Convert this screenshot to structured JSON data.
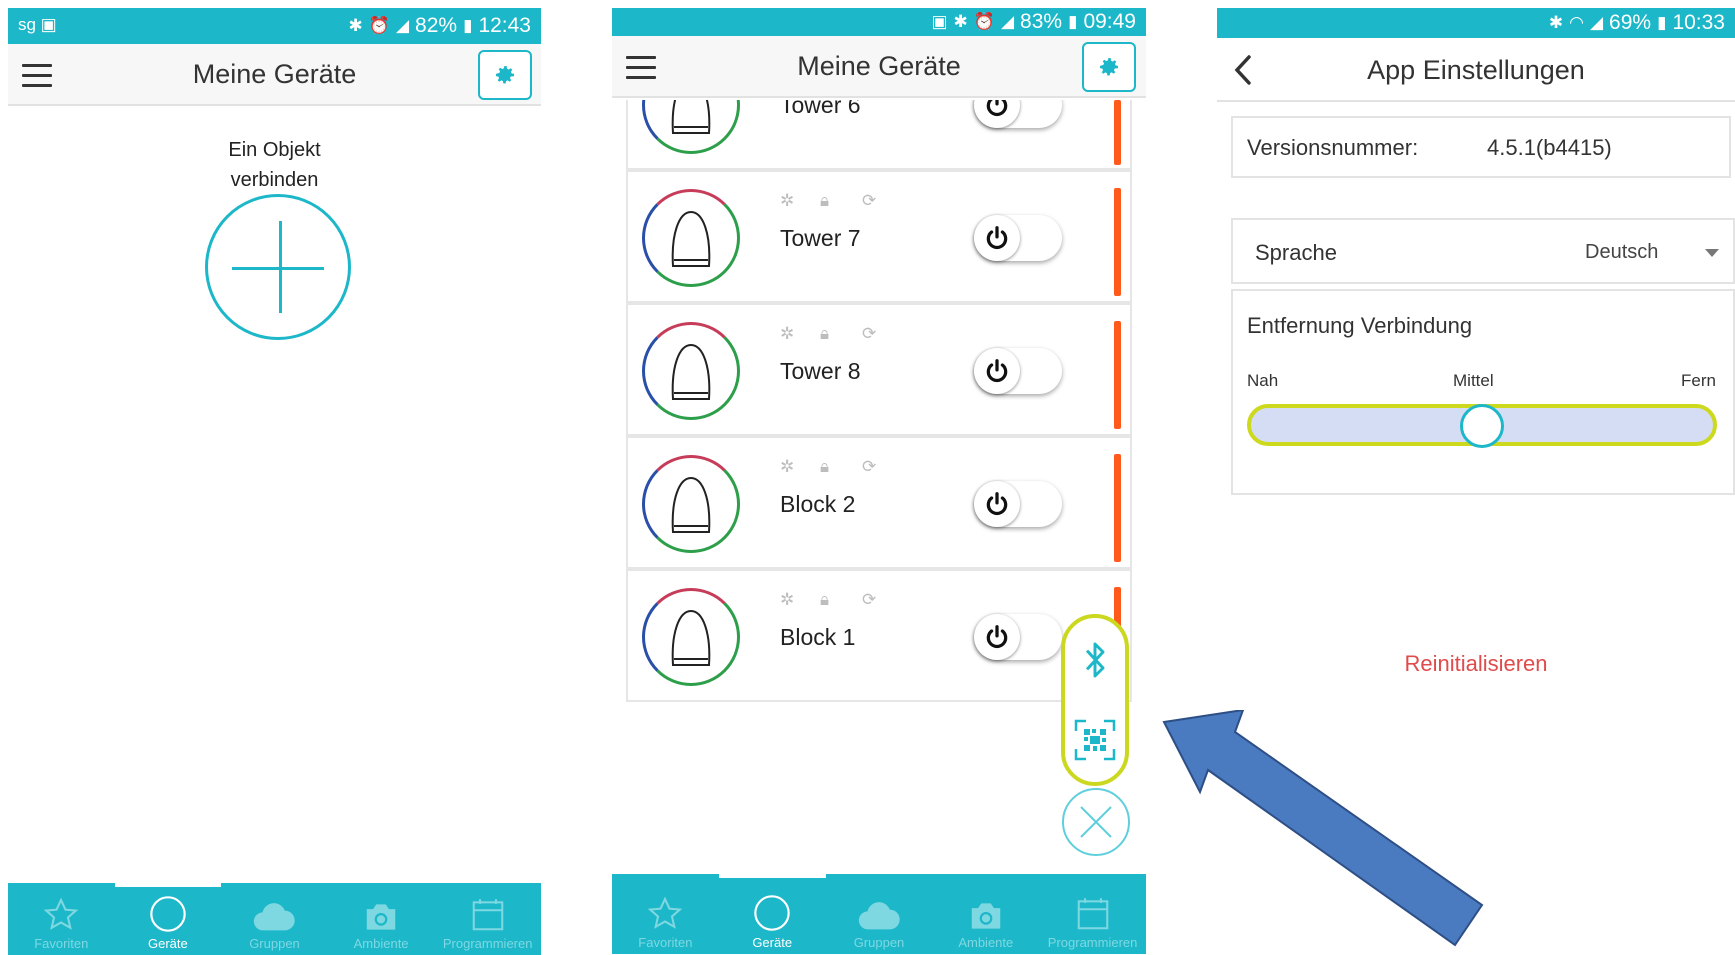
{
  "screen1": {
    "status": {
      "battery": "82%",
      "time": "12:43"
    },
    "title": "Meine Geräte",
    "connect_label_line1": "Ein Objekt",
    "connect_label_line2": "verbinden"
  },
  "screen2": {
    "status": {
      "battery": "83%",
      "time": "09:49"
    },
    "title": "Meine Geräte",
    "devices": [
      {
        "name": "Tower 6"
      },
      {
        "name": "Tower 7"
      },
      {
        "name": "Tower 8"
      },
      {
        "name": "Block 2"
      },
      {
        "name": "Block 1"
      }
    ]
  },
  "screen3": {
    "status": {
      "battery": "69%",
      "time": "10:33"
    },
    "title": "App Einstellungen",
    "version_label": "Versionsnummer:",
    "version_value": "4.5.1(b4415)",
    "language_label": "Sprache",
    "language_value": "Deutsch",
    "distance_label": "Entfernung Verbindung",
    "distance_near": "Nah",
    "distance_mid": "Mittel",
    "distance_far": "Fern",
    "distance_level_fraction": 0.5,
    "reinit_label": "Reinitialisieren"
  },
  "nav": {
    "favorites": "Favoriten",
    "devices": "Geräte",
    "groups": "Gruppen",
    "ambience": "Ambiente",
    "program": "Programmieren"
  },
  "colors": {
    "accent": "#1cb7c8",
    "highlight": "#cbd81f",
    "device_edge": "#ff5a1a",
    "reinit": "#e04b4b",
    "arrow": "#4a7abf"
  }
}
